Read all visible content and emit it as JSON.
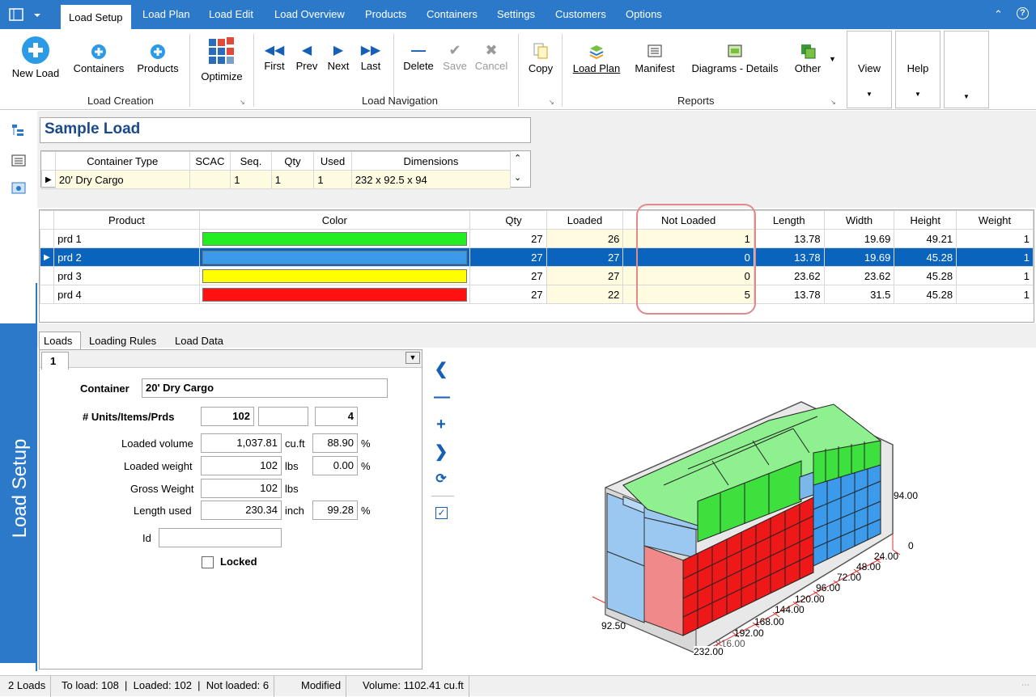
{
  "ribbon_tabs": [
    "Load Setup",
    "Load Plan",
    "Load Edit",
    "Load Overview",
    "Products",
    "Containers",
    "Settings",
    "Customers",
    "Options"
  ],
  "ribbon": {
    "new_load": "New Load",
    "containers": "Containers",
    "products": "Products",
    "optimize": "Optimize",
    "first": "First",
    "prev": "Prev",
    "next": "Next",
    "last": "Last",
    "delete": "Delete",
    "save": "Save",
    "cancel": "Cancel",
    "copy": "Copy",
    "load_plan": "Load Plan",
    "manifest": "Manifest",
    "diagrams": "Diagrams - Details",
    "other": "Other",
    "view": "View",
    "help": "Help",
    "group_load_creation": "Load Creation",
    "group_load_navigation": "Load Navigation",
    "group_reports": "Reports"
  },
  "side_label": "Load Setup",
  "load_name": "Sample Load",
  "container_grid": {
    "headers": [
      "Container Type",
      "SCAC",
      "Seq.",
      "Qty",
      "Used",
      "Dimensions"
    ],
    "row": [
      "20' Dry Cargo",
      "",
      "1",
      "1",
      "1",
      "232 x 92.5 x 94"
    ]
  },
  "product_grid": {
    "headers": [
      "Product",
      "Color",
      "Qty",
      "Loaded",
      "Not Loaded",
      "Length",
      "Width",
      "Height",
      "Weight"
    ],
    "rows": [
      {
        "product": "prd 1",
        "color": "#22ee22",
        "qty": "27",
        "loaded": "26",
        "not_loaded": "1",
        "length": "13.78",
        "width": "19.69",
        "height": "49.21",
        "weight": "1"
      },
      {
        "product": "prd 2",
        "color": "#3b9aea",
        "qty": "27",
        "loaded": "27",
        "not_loaded": "0",
        "length": "13.78",
        "width": "19.69",
        "height": "45.28",
        "weight": "1"
      },
      {
        "product": "prd 3",
        "color": "#ffff00",
        "qty": "27",
        "loaded": "27",
        "not_loaded": "0",
        "length": "23.62",
        "width": "23.62",
        "height": "45.28",
        "weight": "1"
      },
      {
        "product": "prd 4",
        "color": "#ff1111",
        "qty": "27",
        "loaded": "22",
        "not_loaded": "5",
        "length": "13.78",
        "width": "31.5",
        "height": "45.28",
        "weight": "1"
      }
    ]
  },
  "bottom_tabs": [
    "Loads",
    "Loading Rules",
    "Load Data"
  ],
  "load_tab_number": "1",
  "form": {
    "container_label": "Container",
    "container_value": "20' Dry Cargo",
    "units_label": "# Units/Items/Prds",
    "units_value": "102",
    "units_value2": "",
    "units_value3": "4",
    "loaded_volume_label": "Loaded volume",
    "loaded_volume": "1,037.81",
    "volume_unit": "cu.ft",
    "loaded_volume_pct": "88.90",
    "loaded_weight_label": "Loaded weight",
    "loaded_weight": "102",
    "weight_unit": "lbs",
    "loaded_weight_pct": "0.00",
    "gross_weight_label": "Gross Weight",
    "gross_weight": "102",
    "gross_unit": "lbs",
    "length_used_label": "Length used",
    "length_used": "230.34",
    "length_unit": "inch",
    "length_used_pct": "99.28",
    "pct": "%",
    "id_label": "Id",
    "id_value": "",
    "locked_label": "Locked"
  },
  "axis": {
    "height_max": "94.00",
    "zero": "0",
    "width": "92.50",
    "length_ticks": [
      "24.00",
      "48.00",
      "72.00",
      "96.00",
      "120.00",
      "144.00",
      "168.00",
      "192.00",
      "216.00",
      "232.00"
    ]
  },
  "status": {
    "loads": "2 Loads",
    "summary": "To load: 108  |  Loaded: 102  |  Not loaded: 6",
    "modified": "Modified",
    "volume": "Volume: 1102.41 cu.ft"
  },
  "colors": {
    "accent": "#2b79c8",
    "selection": "#0a63bd",
    "highlight": "#e08a8a"
  }
}
